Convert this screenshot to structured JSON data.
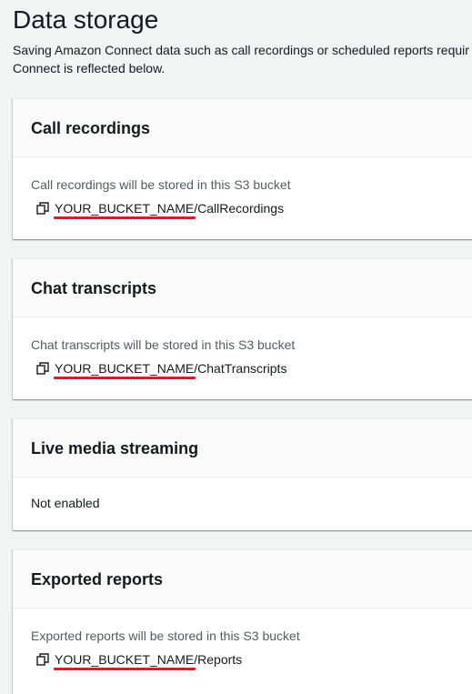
{
  "page": {
    "title": "Data storage",
    "description_line1": "Saving Amazon Connect data such as call recordings or scheduled reports requir",
    "description_line2": "Connect is reflected below."
  },
  "sections": {
    "call_recordings": {
      "title": "Call recordings",
      "description": "Call recordings will be stored in this S3 bucket",
      "bucket": "YOUR_BUCKET_NAME",
      "path": "/CallRecordings"
    },
    "chat_transcripts": {
      "title": "Chat transcripts",
      "description": "Chat transcripts will be stored in this S3 bucket",
      "bucket": "YOUR_BUCKET_NAME",
      "path": "/ChatTranscripts"
    },
    "live_media": {
      "title": "Live media streaming",
      "status": "Not enabled"
    },
    "exported_reports": {
      "title": "Exported reports",
      "description": "Exported reports will be stored in this S3 bucket",
      "bucket": "YOUR_BUCKET_NAME",
      "path": "/Reports"
    }
  },
  "icons": {
    "copy": "copy-icon"
  },
  "colors": {
    "annotation_underline": "#d1202a",
    "secondary_text": "#545b64",
    "header_bg": "#fafafa"
  }
}
